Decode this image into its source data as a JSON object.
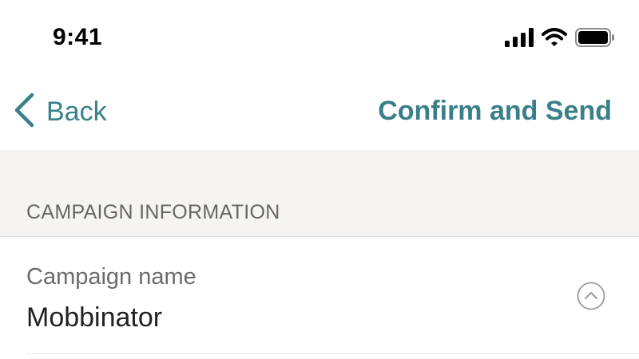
{
  "status_bar": {
    "time": "9:41",
    "icons": [
      "cellular-signal-icon",
      "wifi-icon",
      "battery-icon"
    ]
  },
  "nav": {
    "back_label": "Back",
    "back_icon": "chevron-left-icon",
    "action_label": "Confirm and Send"
  },
  "section": {
    "title": "CAMPAIGN INFORMATION"
  },
  "fields": [
    {
      "label": "Campaign name",
      "value": "Mobbinator",
      "toggle_icon": "chevron-up-circle-icon"
    }
  ],
  "colors": {
    "accent": "#3a7f8a",
    "section_bg": "#f5f4f2",
    "divider": "#e2e2e2",
    "label_text": "#6b6b6b",
    "value_text": "#222222"
  }
}
